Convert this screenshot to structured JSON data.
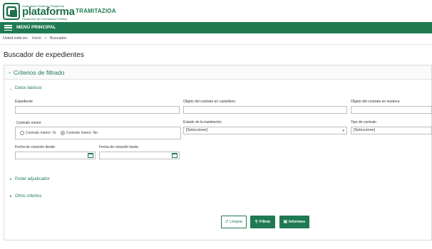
{
  "header": {
    "logo_small_top": "Kontratazio Publikoko Plataforma",
    "logo_name": "plataforma",
    "logo_small_bottom": "Plataforma de Contratación Pública",
    "app_title": "TRAMITAZIOA"
  },
  "menu": {
    "label": "MENÚ PRINCIPAL"
  },
  "breadcrumb": {
    "prefix": "Usted está en:",
    "home": "Inicio",
    "separator": ">",
    "current": "Buscador"
  },
  "page": {
    "title": "Buscador de expedientes"
  },
  "filters": {
    "title": "Criterios de filtrado",
    "sections": {
      "basic": "Datos básicos",
      "adjudicator": "Poder adjudicador",
      "other": "Otros criterios"
    },
    "fields": {
      "expediente": {
        "label": "Expediente",
        "value": ""
      },
      "objeto_cast": {
        "label": "Objeto del contrato en castellano",
        "value": ""
      },
      "objeto_eusk": {
        "label": "Objeto del contrato en euskera",
        "value": ""
      },
      "contrato_menor": {
        "label": "Contrato menor",
        "options": [
          {
            "label": "Contrato menor: Sí",
            "checked": false
          },
          {
            "label": "Contrato menor: No",
            "checked": true
          }
        ]
      },
      "estado": {
        "label": "Estado de la tramitación",
        "value": "[Seleccione]"
      },
      "tipo": {
        "label": "Tipo de contrato",
        "value": "[Seleccione]"
      },
      "fecha_desde": {
        "label": "Fecha de creación desde",
        "value": ""
      },
      "fecha_hasta": {
        "label": "Fecha de creación hasta",
        "value": ""
      }
    }
  },
  "buttons": {
    "clear": "Limpiar",
    "filter": "Filtrar",
    "reports": "Informes"
  },
  "colors": {
    "brand": "#1f7a52",
    "border": "#bdbdbd"
  },
  "icons": {
    "menu": "hamburger-icon",
    "clear": "undo-icon",
    "filter": "search-icon",
    "reports": "document-icon",
    "calendar": "calendar-icon"
  }
}
